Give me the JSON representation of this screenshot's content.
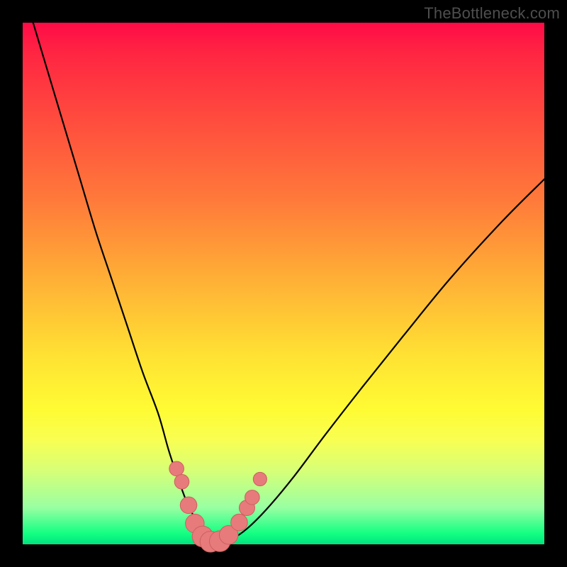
{
  "watermark": "TheBottleneck.com",
  "colors": {
    "frame": "#000000",
    "curve": "#000000",
    "marker_fill": "#e77b7b",
    "marker_stroke": "#cc5f5f",
    "gradient_top": "#ff0b47",
    "gradient_bottom": "#02e27d"
  },
  "chart_data": {
    "type": "line",
    "title": "",
    "xlabel": "",
    "ylabel": "",
    "xlim": [
      0,
      100
    ],
    "ylim": [
      0,
      100
    ],
    "grid": false,
    "legend": false,
    "series": [
      {
        "name": "v-curve",
        "x": [
          2,
          5,
          8,
          11,
          14,
          17,
          20,
          23,
          26,
          28,
          30,
          31.5,
          33,
          34.5,
          36,
          37.5,
          40,
          43,
          47,
          52,
          58,
          65,
          73,
          82,
          92,
          100
        ],
        "y": [
          100,
          90,
          80,
          70,
          60,
          51,
          42,
          33,
          25,
          18,
          12,
          8,
          5,
          2.5,
          1,
          0.5,
          1,
          3,
          7,
          13,
          21,
          30,
          40,
          51,
          62,
          70
        ]
      }
    ],
    "markers": [
      {
        "x": 29.5,
        "y": 14.5,
        "r": 1.4
      },
      {
        "x": 30.5,
        "y": 12.0,
        "r": 1.4
      },
      {
        "x": 31.8,
        "y": 7.5,
        "r": 1.6
      },
      {
        "x": 33.0,
        "y": 4.0,
        "r": 1.8
      },
      {
        "x": 34.5,
        "y": 1.5,
        "r": 2.0
      },
      {
        "x": 36.0,
        "y": 0.5,
        "r": 2.0
      },
      {
        "x": 37.8,
        "y": 0.6,
        "r": 2.0
      },
      {
        "x": 39.5,
        "y": 1.8,
        "r": 1.8
      },
      {
        "x": 41.5,
        "y": 4.2,
        "r": 1.6
      },
      {
        "x": 43.0,
        "y": 7.0,
        "r": 1.5
      },
      {
        "x": 44.0,
        "y": 9.0,
        "r": 1.4
      },
      {
        "x": 45.5,
        "y": 12.5,
        "r": 1.3
      }
    ]
  }
}
